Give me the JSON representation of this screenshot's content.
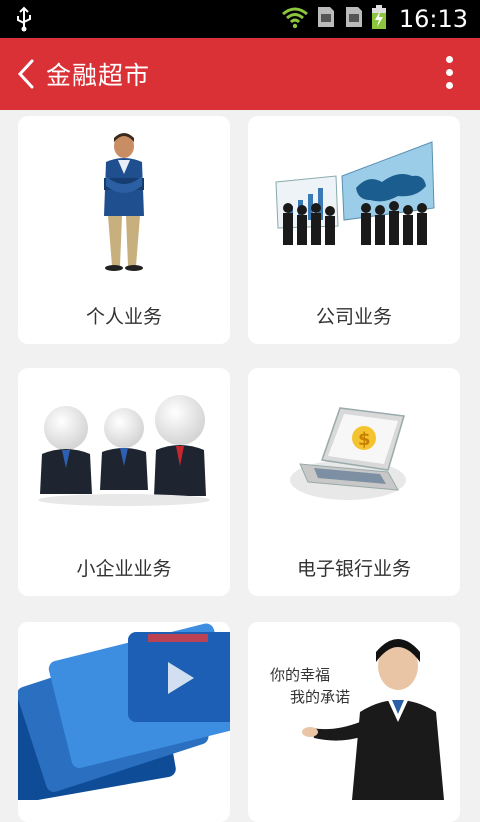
{
  "status": {
    "time": "16:13"
  },
  "appbar": {
    "title": "金融超市"
  },
  "cards": [
    {
      "label": "个人业务"
    },
    {
      "label": "公司业务"
    },
    {
      "label": "小企业业务"
    },
    {
      "label": "电子银行业务"
    },
    {
      "label": ""
    },
    {
      "label": ""
    }
  ],
  "images": {
    "service_banner_text_line1": "你的幸福",
    "service_banner_text_line2": "我的承诺"
  },
  "colors": {
    "brand": "#d93136",
    "background": "#f1f1f1"
  }
}
